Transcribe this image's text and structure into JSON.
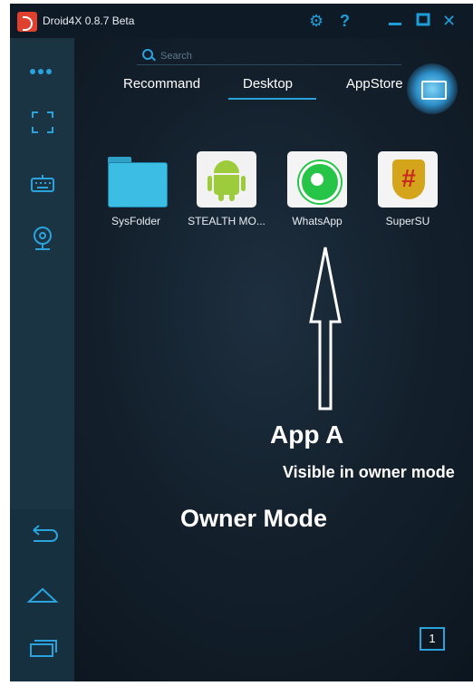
{
  "window": {
    "title": "Droid4X 0.8.7 Beta"
  },
  "titlebar": {
    "settings_icon": "gear-icon",
    "help_label": "?",
    "minimize_icon": "minimize-icon",
    "maximize_icon": "maximize-icon",
    "close_label": "✕"
  },
  "search": {
    "placeholder": "Search"
  },
  "tabs": [
    {
      "label": "Recommand",
      "active": false
    },
    {
      "label": "Desktop",
      "active": true
    },
    {
      "label": "AppStore",
      "active": false
    }
  ],
  "apps": [
    {
      "label": "SysFolder",
      "icon": "folder-icon"
    },
    {
      "label": "STEALTH MO...",
      "icon": "android-icon"
    },
    {
      "label": "WhatsApp",
      "icon": "whatsapp-icon"
    },
    {
      "label": "SuperSU",
      "icon": "supersu-icon"
    }
  ],
  "sidebar": {
    "icons": [
      "more-icon",
      "fullscreen-icon",
      "keyboard-icon",
      "webcam-icon",
      "back-icon",
      "home-icon",
      "recent-apps-icon"
    ]
  },
  "annotation": {
    "title": "App A",
    "subtitle": "Visible in owner mode",
    "mode": "Owner Mode"
  },
  "page_indicator": "1",
  "colors": {
    "accent": "#2aa3dd",
    "sidebar": "#1a3444",
    "titlebar": "#0e1a25"
  }
}
